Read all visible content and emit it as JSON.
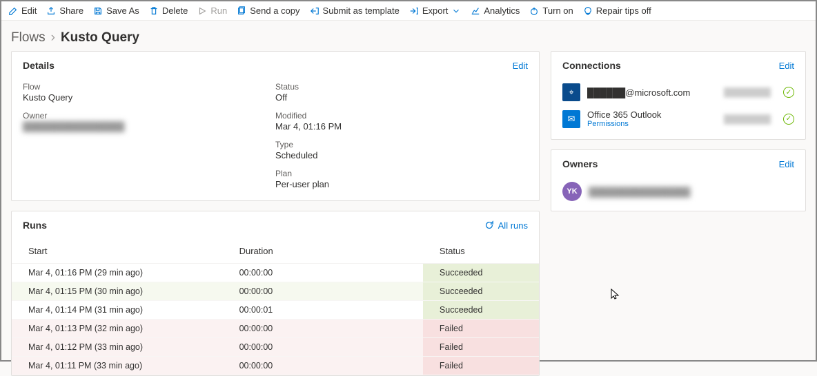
{
  "toolbar": {
    "edit": "Edit",
    "share": "Share",
    "saveAs": "Save As",
    "delete": "Delete",
    "run": "Run",
    "sendCopy": "Send a copy",
    "submitTemplate": "Submit as template",
    "export": "Export",
    "analytics": "Analytics",
    "turnOn": "Turn on",
    "repairTips": "Repair tips off"
  },
  "breadcrumb": {
    "root": "Flows",
    "current": "Kusto Query"
  },
  "details": {
    "title": "Details",
    "editLink": "Edit",
    "flowLabel": "Flow",
    "flowValue": "Kusto Query",
    "ownerLabel": "Owner",
    "ownerValue": "████████████████",
    "statusLabel": "Status",
    "statusValue": "Off",
    "modifiedLabel": "Modified",
    "modifiedValue": "Mar 4, 01:16 PM",
    "typeLabel": "Type",
    "typeValue": "Scheduled",
    "planLabel": "Plan",
    "planValue": "Per-user plan"
  },
  "connections": {
    "title": "Connections",
    "editLink": "Edit",
    "items": [
      {
        "icon": "kusto",
        "name": "██████@microsoft.com",
        "sub": "",
        "account": "████████"
      },
      {
        "icon": "outlook",
        "name": "Office 365 Outlook",
        "sub": "Permissions",
        "account": "████████"
      }
    ]
  },
  "owners": {
    "title": "Owners",
    "editLink": "Edit",
    "initials": "YK",
    "name": "████████████████"
  },
  "runs": {
    "title": "Runs",
    "allRuns": "All runs",
    "columns": {
      "start": "Start",
      "duration": "Duration",
      "status": "Status"
    },
    "rows": [
      {
        "start": "Mar 4, 01:16 PM (29 min ago)",
        "duration": "00:00:00",
        "status": "Succeeded",
        "cls": "plain-succ"
      },
      {
        "start": "Mar 4, 01:15 PM (30 min ago)",
        "duration": "00:00:00",
        "status": "Succeeded",
        "cls": "succ"
      },
      {
        "start": "Mar 4, 01:14 PM (31 min ago)",
        "duration": "00:00:01",
        "status": "Succeeded",
        "cls": "plain-succ"
      },
      {
        "start": "Mar 4, 01:13 PM (32 min ago)",
        "duration": "00:00:00",
        "status": "Failed",
        "cls": "fail"
      },
      {
        "start": "Mar 4, 01:12 PM (33 min ago)",
        "duration": "00:00:00",
        "status": "Failed",
        "cls": "fail"
      },
      {
        "start": "Mar 4, 01:11 PM (33 min ago)",
        "duration": "00:00:00",
        "status": "Failed",
        "cls": "fail"
      }
    ]
  }
}
